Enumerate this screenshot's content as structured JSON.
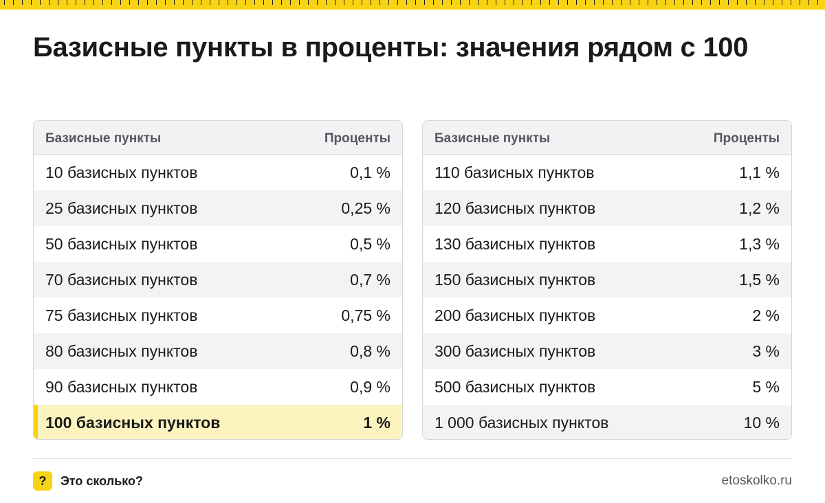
{
  "title": "Базисные пункты в проценты: значения рядом с 100",
  "tables": {
    "left": {
      "header": {
        "col1": "Базисные пункты",
        "col2": "Проценты"
      },
      "rows": [
        {
          "bp": "10 базисных пунктов",
          "pct": "0,1 %"
        },
        {
          "bp": "25 базисных пунктов",
          "pct": "0,25 %"
        },
        {
          "bp": "50 базисных пунктов",
          "pct": "0,5 %"
        },
        {
          "bp": "70 базисных пунктов",
          "pct": "0,7 %"
        },
        {
          "bp": "75 базисных пунктов",
          "pct": "0,75 %"
        },
        {
          "bp": "80 базисных пунктов",
          "pct": "0,8 %"
        },
        {
          "bp": "90 базисных пунктов",
          "pct": "0,9 %"
        },
        {
          "bp": "100 базисных пунктов",
          "pct": "1 %",
          "highlighted": true
        }
      ]
    },
    "right": {
      "header": {
        "col1": "Базисные пункты",
        "col2": "Проценты"
      },
      "rows": [
        {
          "bp": "110 базисных пунктов",
          "pct": "1,1 %"
        },
        {
          "bp": "120 базисных пунктов",
          "pct": "1,2 %"
        },
        {
          "bp": "130 базисных пунктов",
          "pct": "1,3 %"
        },
        {
          "bp": "150 базисных пунктов",
          "pct": "1,5 %"
        },
        {
          "bp": "200 базисных пунктов",
          "pct": "2 %"
        },
        {
          "bp": "300 базисных пунктов",
          "pct": "3 %"
        },
        {
          "bp": "500 базисных пунктов",
          "pct": "5 %"
        },
        {
          "bp": "1 000 базисных пунктов",
          "pct": "10 %"
        }
      ]
    }
  },
  "footer": {
    "brand_icon": "?",
    "brand_name": "Это сколько?",
    "site": "etoskolko.ru"
  },
  "colors": {
    "accent": "#f8d314",
    "highlight_row": "#fdf3bf"
  }
}
